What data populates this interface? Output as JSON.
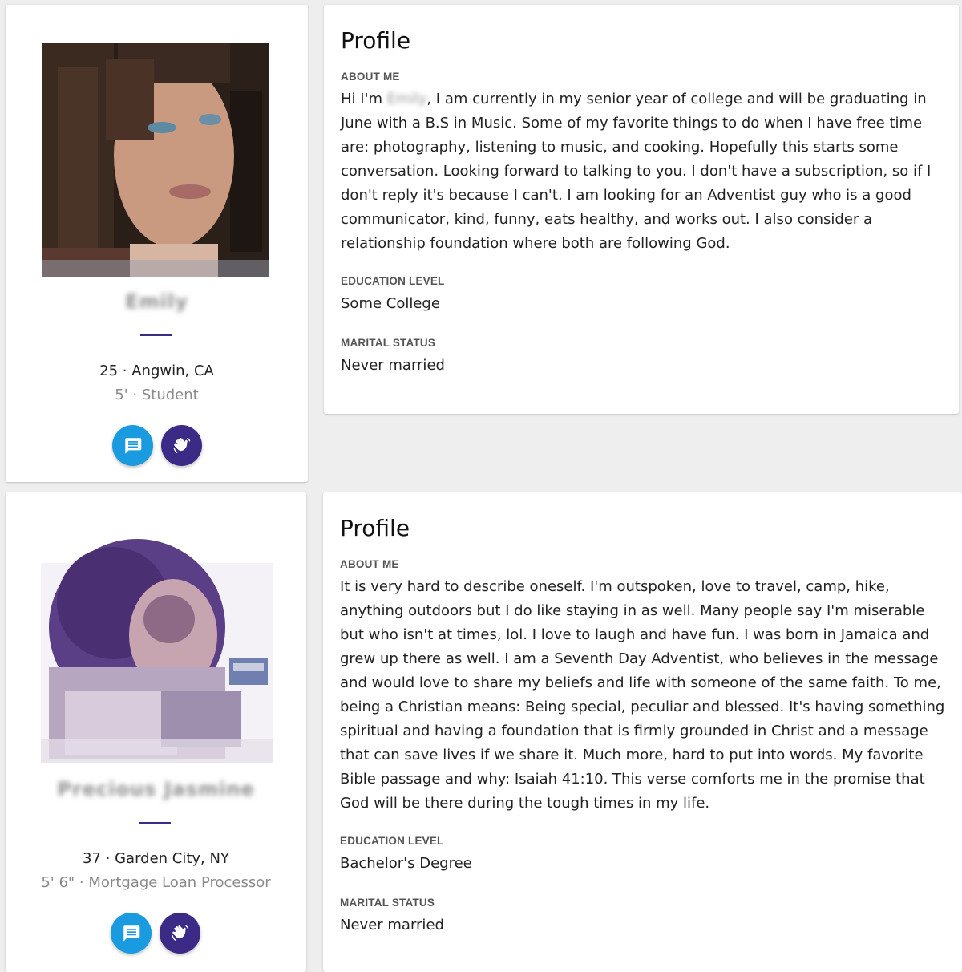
{
  "profiles": [
    {
      "name": "Emily",
      "age": "25",
      "location": "Angwin, CA",
      "line1": "25 · Angwin, CA",
      "line2": "5' · Student",
      "actions": {
        "message_icon": "chat-bubble-icon",
        "wave_icon": "waving-hand-icon"
      },
      "section_title": "Profile",
      "about_label": "ABOUT ME",
      "about_prefix": "Hi I'm ",
      "about_blurred_name": "Emily",
      "about_text": ", I am currently in my senior year of college and will be graduating in June with a B.S in Music. Some of my favorite things to do when I have free time are: photography, listening to music, and cooking. Hopefully this starts some conversation. Looking forward to talking to you. I don't have a subscription, so if I don't reply it's because I can't. I am looking for an Adventist guy who is a good communicator, kind, funny, eats healthy, and works out. I also consider a relationship foundation where both are following God.",
      "education_label": "EDUCATION LEVEL",
      "education_value": "Some College",
      "marital_label": "MARITAL STATUS",
      "marital_value": "Never married"
    },
    {
      "name": "Precious Jasmine",
      "age": "37",
      "location": "Garden City, NY",
      "line1": "37 · Garden City, NY",
      "line2": "5' 6\" · Mortgage Loan Processor",
      "actions": {
        "message_icon": "chat-bubble-icon",
        "wave_icon": "waving-hand-icon"
      },
      "section_title": "Profile",
      "about_label": "ABOUT ME",
      "about_text": "It is very hard to describe oneself. I'm outspoken, love to travel, camp, hike, anything outdoors but I do like staying in as well. Many people say I'm miserable but who isn't at times, lol. I love to laugh and have fun. I was born in Jamaica and grew up there as well. I am a Seventh Day Adventist, who believes in the message and would love to share my beliefs and life with someone of the same faith. To me, being a Christian means: Being special, peculiar and blessed. It's having something spiritual and having a foundation that is firmly grounded in Christ and a message that can save lives if we share it. Much more, hard to put into words. My favorite Bible passage and why: Isaiah 41:10. This verse comforts me in the promise that God will be there during the tough times in my life.",
      "education_label": "EDUCATION LEVEL",
      "education_value": "Bachelor's Degree",
      "marital_label": "MARITAL STATUS",
      "marital_value": "Never married"
    }
  ],
  "colors": {
    "background": "#eeeeee",
    "card": "#ffffff",
    "accent_purple": "#3b2a86",
    "accent_blue": "#1a9be0",
    "muted_text": "#8a8a8a"
  }
}
